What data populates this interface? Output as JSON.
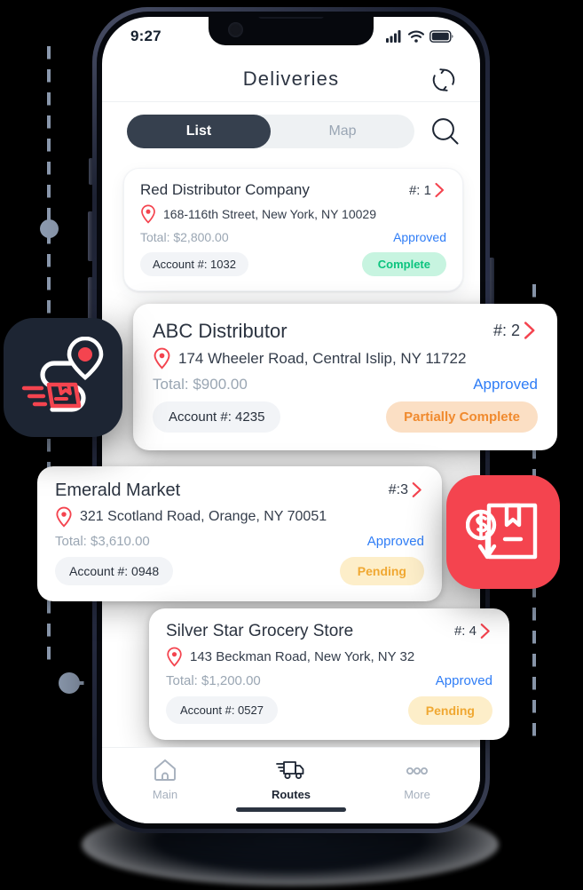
{
  "status_bar": {
    "time": "9:27",
    "signal_icon": "cellular-signal-icon",
    "wifi_icon": "wifi-icon",
    "battery_icon": "battery-icon"
  },
  "header": {
    "title": "Deliveries",
    "refresh_icon": "refresh-icon"
  },
  "toolbar": {
    "tabs": [
      {
        "label": "List",
        "active": true
      },
      {
        "label": "Map",
        "active": false
      }
    ],
    "search_icon": "search-icon"
  },
  "colors": {
    "accent_red": "#f4444f",
    "approved_blue": "#2f7df6",
    "complete_green": "#0bc47e",
    "complete_green_bg": "#c7f4e0",
    "partial_orange": "#f08a2e",
    "partial_orange_bg": "#fbdfc4",
    "pending_amber": "#f0a832",
    "pending_amber_bg": "#fdeec9",
    "dark_navy": "#1d2533"
  },
  "deliveries": [
    {
      "name": "Red  Distributor Company",
      "index_label": "#: 1",
      "address": "168-116th Street, New York, NY 10029",
      "total": "Total: $2,800.00",
      "approval": "Approved",
      "account": "Account #: 1032",
      "status": "Complete",
      "status_kind": "complete"
    },
    {
      "name": "ABC Distributor",
      "index_label": "#: 2",
      "address": "174 Wheeler Road, Central Islip, NY 11722",
      "total": "Total: $900.00",
      "approval": "Approved",
      "account": "Account #: 4235",
      "status": "Partially Complete",
      "status_kind": "partial"
    },
    {
      "name": "Emerald Market",
      "index_label": "#:3",
      "address": "321 Scotland Road, Orange, NY 70051",
      "total": "Total: $3,610.00",
      "approval": "Approved",
      "account": "Account #: 0948",
      "status": "Pending",
      "status_kind": "pending"
    },
    {
      "name": "Silver Star Grocery Store",
      "index_label": "#: 4",
      "address": "143 Beckman Road, New York, NY 32",
      "total": "Total: $1,200.00",
      "approval": "Approved",
      "account": "Account #: 0527",
      "status": "Pending",
      "status_kind": "pending"
    }
  ],
  "tabbar": {
    "items": [
      {
        "label": "Main",
        "icon": "home-icon",
        "active": false
      },
      {
        "label": "Routes",
        "icon": "truck-icon",
        "active": true
      },
      {
        "label": "More",
        "icon": "ellipsis-icon",
        "active": false
      }
    ]
  },
  "floating_badges": [
    {
      "name": "route-package-badge",
      "icon": "route-pin-package-icon"
    },
    {
      "name": "cost-per-delivery-badge",
      "icon": "box-dollar-arrow-icon"
    }
  ]
}
